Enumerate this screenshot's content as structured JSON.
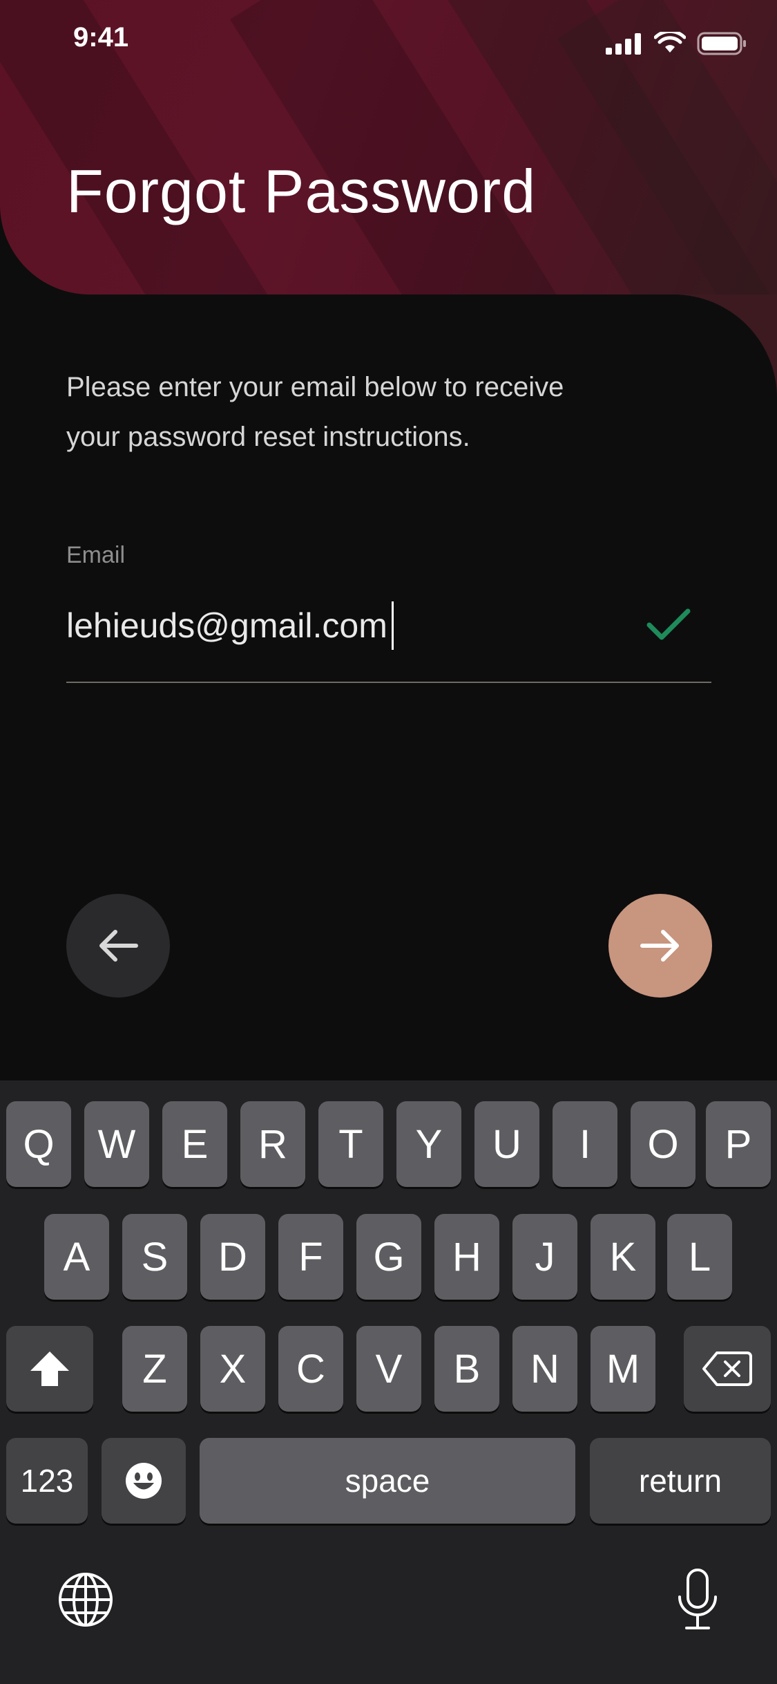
{
  "status_bar": {
    "time": "9:41"
  },
  "header": {
    "title": "Forgot Password"
  },
  "instructions": {
    "line1": "Please enter your email below to receive",
    "line2": "your password reset instructions."
  },
  "email_field": {
    "label": "Email",
    "value": "lehieuds@gmail.com"
  },
  "keyboard": {
    "row1": [
      "Q",
      "W",
      "E",
      "R",
      "T",
      "Y",
      "U",
      "I",
      "O",
      "P"
    ],
    "row2": [
      "A",
      "S",
      "D",
      "F",
      "G",
      "H",
      "J",
      "K",
      "L"
    ],
    "row3": [
      "Z",
      "X",
      "C",
      "V",
      "B",
      "N",
      "M"
    ],
    "numbers_label": "123",
    "space_label": "space",
    "return_label": "return"
  },
  "colors": {
    "header": "#5b1224",
    "background": "#0d0d0e",
    "accent": "#c8957f",
    "check": "#1f8a5a"
  },
  "icons": {
    "signal": "cellular-signal-icon",
    "wifi": "wifi-icon",
    "battery": "battery-icon",
    "back": "arrow-left-icon",
    "next": "arrow-right-icon",
    "valid": "checkmark-icon",
    "shift": "shift-icon",
    "delete": "backspace-icon",
    "emoji": "emoji-icon",
    "globe": "globe-icon",
    "mic": "microphone-icon"
  }
}
